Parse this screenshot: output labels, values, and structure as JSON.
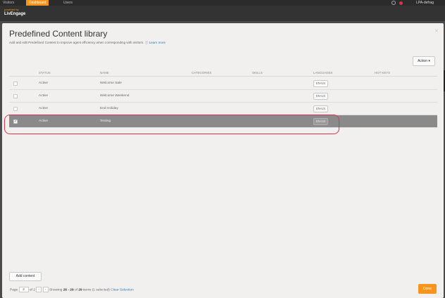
{
  "topnav": {
    "tabs": [
      {
        "label": "Visitors"
      },
      {
        "label": "Dashboard"
      },
      {
        "label": "Users"
      }
    ],
    "user_label": "LPA-defrag",
    "brand_small": "powered by",
    "brand": "LivEngage"
  },
  "modal": {
    "title": "Predefined Content library",
    "subtitle": "Add and edit Predefined Content to improve agent efficiency when corresponding with visitors.",
    "learn_more": "Learn more",
    "close_glyph": "×",
    "action_label": "Action ▾"
  },
  "table": {
    "columns": [
      "STATUS",
      "NAME",
      "CATEGORIES",
      "SKILLS",
      "LANGUAGES",
      "HOT KEYS"
    ],
    "rows": [
      {
        "status": "Active",
        "name": "Welcome Sale",
        "language": "EN-US",
        "checked": false
      },
      {
        "status": "Active",
        "name": "Welcome Weekend",
        "language": "EN-US",
        "checked": false
      },
      {
        "status": "Active",
        "name": "End Holiday",
        "language": "EN-US",
        "checked": false
      },
      {
        "status": "Active",
        "name": "Testing",
        "language": "EN-US",
        "checked": true
      }
    ]
  },
  "footer": {
    "add_content": "Add content",
    "page_label": "Page",
    "page_value": "2",
    "of_label": "of",
    "total_pages": "2",
    "showing_prefix": "Showing",
    "range": "26 - 29",
    "of_items_prefix": "of",
    "total_items": "29",
    "items_suffix": "items (1 selected)",
    "clear_selection": "Clear Selection",
    "done": "Done",
    "prev_glyph": "‹",
    "next_glyph": "›"
  },
  "colors": {
    "accent": "#f7941d",
    "highlight": "#e0324b",
    "link": "#2a7ab8"
  }
}
